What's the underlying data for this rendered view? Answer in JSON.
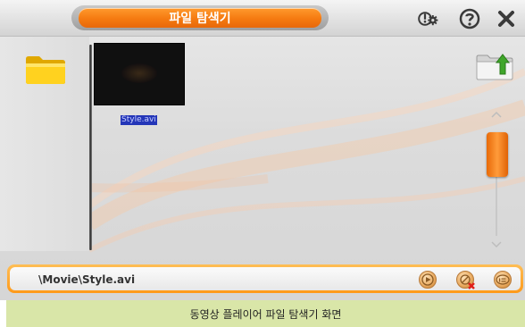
{
  "window": {
    "title": "파일 탐색기"
  },
  "toolbar": {
    "settings_icon": "settings-gear-icon",
    "help_icon": "help-question-icon",
    "close_icon": "close-x-icon"
  },
  "files": [
    {
      "name": "Style.avi",
      "selected": true
    }
  ],
  "path": {
    "current": "\\Movie\\Style.avi"
  },
  "caption": "동영상 플레이어 파일 탐색기 화면",
  "colors": {
    "accent": "#f57a10",
    "selection": "#2436b8",
    "caption_bg": "#d9e6a8"
  }
}
